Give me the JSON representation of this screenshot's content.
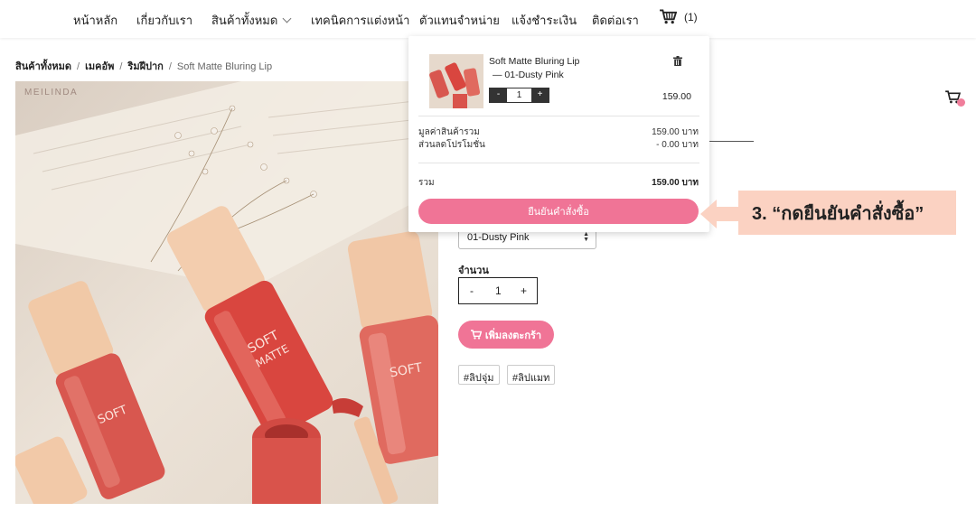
{
  "nav": {
    "items": [
      "หน้าหลัก",
      "เกี่ยวกับเรา",
      "สินค้าทั้งหมด",
      "เทคนิคการแต่งหน้า",
      "ตัวแทนจำหน่าย",
      "แจ้งชำระเงิน",
      "ติดต่อเรา"
    ],
    "cart_count": "(1)"
  },
  "breadcrumb": {
    "items": [
      "สินค้าทั้งหมด",
      "เมคอัพ",
      "ริมฝีปาก"
    ],
    "current": "Soft Matte Bluring Lip"
  },
  "product": {
    "brand_watermark": "MEILINDA",
    "variant_selected": "01-Dusty Pink",
    "qty_label": "จำนวน",
    "qty_minus": "-",
    "qty_value": "1",
    "qty_plus": "+",
    "add_to_cart_label": "เพิ่มลงตะกร้า",
    "tags": [
      "#ลิปจุ่ม",
      "#ลิปแมท"
    ]
  },
  "cart_dropdown": {
    "item": {
      "name": "Soft Matte Bluring Lip",
      "variant": "— 01-Dusty Pink",
      "qty_minus": "-",
      "qty": "1",
      "qty_plus": "+",
      "price": "159.00"
    },
    "subtotal_label": "มูลค่าสินค้ารวม",
    "subtotal_value": "159.00 บาท",
    "discount_label": "ส่วนลดโปรโมชั่น",
    "discount_value": "- 0.00 บาท",
    "total_label": "รวม",
    "total_value": "159.00 บาท",
    "confirm_label": "ยืนยันคำสั่งซื้อ"
  },
  "annotation": {
    "text": "3. “กดยืนยันคำสั่งซื้อ”"
  },
  "colors": {
    "accent_pink": "#f07496",
    "annotation_bg": "#fbd2c2",
    "cart_badge": "#f07e9b"
  },
  "icons": [
    "cart-icon",
    "chevron-down-icon",
    "trash-icon",
    "select-arrows-icon",
    "arrow-left-icon"
  ]
}
